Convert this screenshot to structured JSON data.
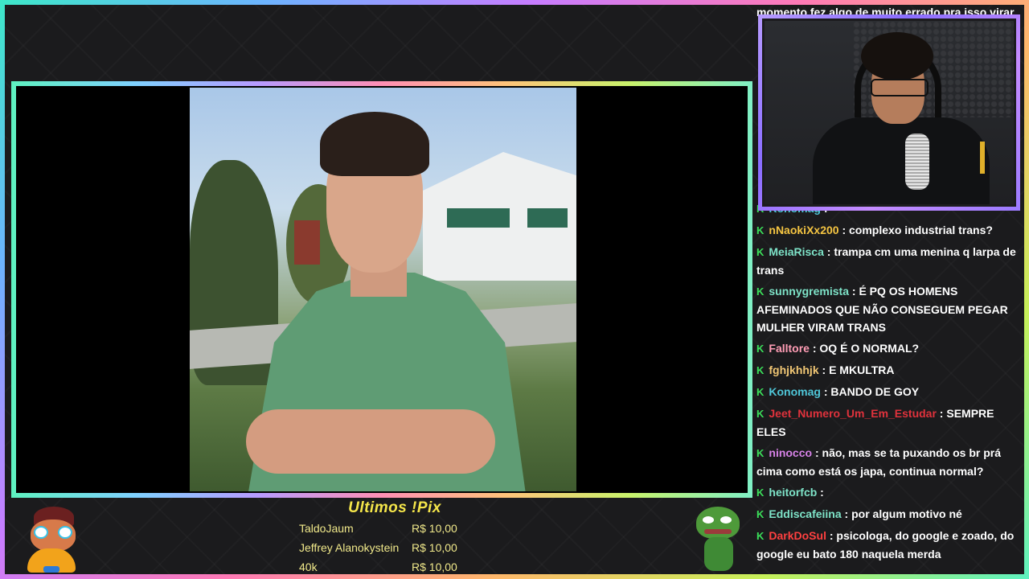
{
  "chat": {
    "top_fragment": "momento fez algo de muito errado pra isso virar",
    "messages": [
      {
        "user": "Konomag",
        "user_color": "#4fc7d9",
        "text": ""
      },
      {
        "user": "nNaokiXx200",
        "user_color": "#f5c542",
        "text": "complexo industrial trans?"
      },
      {
        "user": "MeiaRisca",
        "user_color": "#7ee3c8",
        "text": "trampa cm uma menina q larpa de trans"
      },
      {
        "user": "sunnygremista",
        "user_color": "#7ee3c8",
        "text": "É PQ OS HOMENS AFEMINADOS QUE NÃO CONSEGUEM PEGAR MULHER VIRAM TRANS"
      },
      {
        "user": "Falltore",
        "user_color": "#ff9db5",
        "text": "OQ É O NORMAL?"
      },
      {
        "user": "fghjkhhjk",
        "user_color": "#f0c674",
        "text": "E MKULTRA"
      },
      {
        "user": "Konomag",
        "user_color": "#4fc7d9",
        "text": "BANDO DE GOY"
      },
      {
        "user": "Jeet_Numero_Um_Em_Estudar",
        "user_color": "#e0323c",
        "text": "SEMPRE ELES"
      },
      {
        "user": "ninocco",
        "user_color": "#d782e8",
        "text": "não, mas se ta puxando os br prá cima como está os japa, continua normal?"
      },
      {
        "user": "heitorfcb",
        "user_color": "#7ee3c8",
        "text": ""
      },
      {
        "user": "Eddiscafeiina",
        "user_color": "#7ee3c8",
        "text": "por algum motivo né"
      },
      {
        "user": "DarkDoSul",
        "user_color": "#ff4040",
        "text": "psicologa, do google e zoado, do google eu bato 180 naquela merda"
      }
    ]
  },
  "pix": {
    "title": "Ultimos !Pix",
    "rows": [
      {
        "name": "TaldoJaum",
        "value": "R$ 10,00"
      },
      {
        "name": "Jeffrey Alanokystein",
        "value": "R$ 10,00"
      },
      {
        "name": "40k",
        "value": "R$ 10,00"
      }
    ]
  },
  "icons": {
    "mod_badge": "K",
    "emote": "hand-emote"
  }
}
